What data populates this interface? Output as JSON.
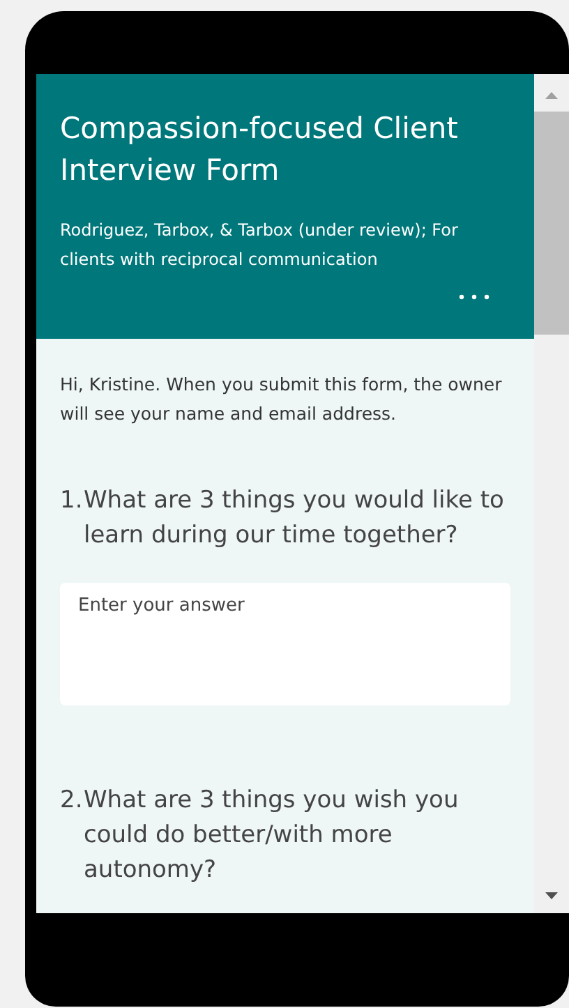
{
  "form": {
    "title": "Compassion-focused Client Interview Form",
    "subtitle": "Rodriguez, Tarbox, & Tarbox (under review); For clients with reciprocal communication"
  },
  "notice": "Hi, Kristine. When you submit this form, the owner will see your name and email address.",
  "questions": [
    {
      "number": "1.",
      "text": "What are 3 things you would like to learn during our time together?",
      "placeholder": "Enter your answer"
    },
    {
      "number": "2.",
      "text": "What are 3 things you wish you could do better/with more autonomy?"
    }
  ]
}
